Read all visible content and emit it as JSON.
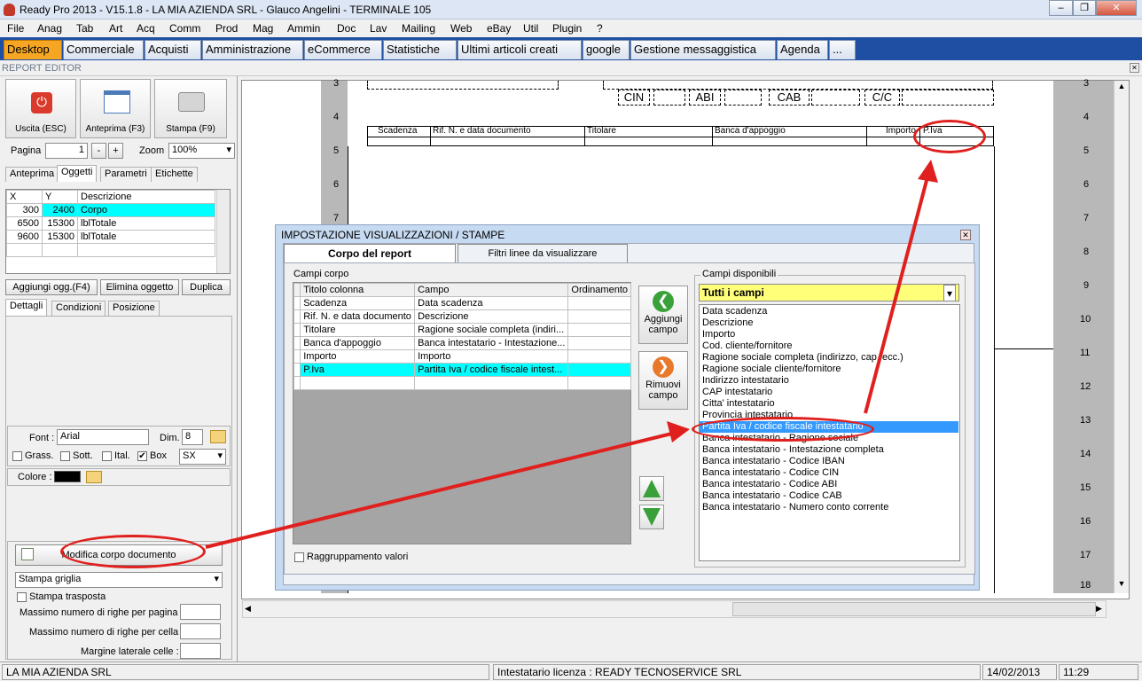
{
  "window": {
    "title": "Ready Pro 2013 - V15.1.8 - LA MIA AZIENDA SRL - Glauco Angelini - TERMINALE 105",
    "controls": [
      "minimize",
      "restore",
      "close"
    ]
  },
  "menu": [
    "File",
    "Anag",
    "Tab",
    "Art",
    "Acq",
    "Comm",
    "Prod",
    "Mag",
    "Ammin",
    "Doc",
    "Lav",
    "Mailing",
    "Web",
    "eBay",
    "Util",
    "Plugin",
    "?"
  ],
  "tabs": [
    "Desktop",
    "Commerciale",
    "Acquisti",
    "Amministrazione",
    "eCommerce",
    "Statistiche",
    "Ultimi articoli creati",
    "google",
    "Gestione messaggistica",
    "Agenda",
    "..."
  ],
  "report_editor": {
    "title": "REPORT EDITOR",
    "buttons": {
      "exit": "Uscita (ESC)",
      "preview": "Anteprima (F3)",
      "print": "Stampa (F9)"
    },
    "page_label": "Pagina",
    "page_value": "1",
    "minus": "-",
    "plus": "+",
    "zoom_label": "Zoom",
    "zoom_value": "100%",
    "tabs": [
      "Anteprima",
      "Oggetti",
      "Parametri",
      "Etichette"
    ],
    "objects_table": {
      "columns": [
        "X",
        "Y",
        "Descrizione"
      ],
      "rows": [
        [
          "300",
          "2400",
          "Corpo"
        ],
        [
          "6500",
          "15300",
          "lblTotale"
        ],
        [
          "9600",
          "15300",
          "lblTotale"
        ]
      ]
    },
    "obj_buttons": {
      "add": "Aggiungi ogg.(F4)",
      "delete": "Elimina oggetto",
      "duplicate": "Duplica"
    },
    "detail_tabs": [
      "Dettagli",
      "Condizioni",
      "Posizione"
    ],
    "font_label": "Font :",
    "font_value": "Arial",
    "dim_label": "Dim.",
    "dim_value": "8",
    "checks": {
      "bold": "Grass.",
      "underline": "Sott.",
      "italic": "Ital.",
      "box": "Box"
    },
    "box_checked": "✔",
    "align_value": "SX",
    "color_label": "Colore :",
    "edit_body_button": "Modifica corpo documento",
    "grid_select": "Stampa griglia",
    "transposed": "Stampa trasposta",
    "max_rows_page": "Massimo numero di righe per pagina :",
    "max_rows_cell": "Massimo numero di righe per cella :",
    "side_margin": "Margine laterale celle :"
  },
  "canvas": {
    "ruler_numbers": [
      "3",
      "4",
      "5",
      "6",
      "7",
      "8",
      "9",
      "10",
      "11",
      "12",
      "13",
      "14",
      "15",
      "16",
      "17",
      "18"
    ],
    "top_labels": [
      "CIN",
      "ABI",
      "CAB",
      "C/C"
    ],
    "body_headers": [
      "Scadenza",
      "Rif. N. e data documento",
      "Titolare",
      "Banca d'appoggio",
      "Importo",
      "P.Iva"
    ]
  },
  "dialog": {
    "title": "IMPOSTAZIONE VISUALIZZAZIONI / STAMPE",
    "tabs": [
      "Corpo del report",
      "Filtri linee da visualizzare"
    ],
    "body_fields_label": "Campi corpo",
    "columns": [
      "Titolo colonna",
      "Campo",
      "Ordinamento"
    ],
    "rows": [
      [
        "Scadenza",
        "Data scadenza",
        ""
      ],
      [
        "Rif. N. e data documento",
        "Descrizione",
        ""
      ],
      [
        "Titolare",
        "Ragione sociale completa (indiri...",
        ""
      ],
      [
        "Banca d'appoggio",
        "Banca intestatario - Intestazione...",
        ""
      ],
      [
        "Importo",
        "Importo",
        ""
      ],
      [
        "P.Iva",
        "Partita Iva / codice fiscale intest...",
        ""
      ]
    ],
    "add_field": "Aggiungi campo",
    "remove_field": "Rimuovi campo",
    "group_values": "Raggruppamento valori",
    "available_label": "Campi disponibili",
    "filter_value": "Tutti i campi",
    "available_fields": [
      "Data scadenza",
      "Descrizione",
      "Importo",
      "Cod. cliente/fornitore",
      "Ragione sociale completa (indirizzo, cap, ecc.)",
      "Ragione sociale cliente/fornitore",
      "Indirizzo intestatario",
      "CAP intestatario",
      "Citta' intestatario",
      "Provincia intestatario",
      "Partita Iva / codice fiscale intestatario",
      "Banca intestatario - Ragione sociale",
      "Banca intestatario - Intestazione completa",
      "Banca intestatario - Codice IBAN",
      "Banca intestatario - Codice CIN",
      "Banca intestatario - Codice ABI",
      "Banca intestatario - Codice CAB",
      "Banca intestatario - Numero conto corrente"
    ]
  },
  "status": {
    "company": "LA MIA AZIENDA SRL",
    "license": "Intestatario licenza : READY TECNOSERVICE SRL",
    "date": "14/02/2013",
    "time": "11:29"
  },
  "colors": {
    "tabbar": "#1f4fa3",
    "active_tab": "#f6a623",
    "selection": "#00ffff",
    "annotation": "#e0201e",
    "dialog_bg": "#c6daf1"
  }
}
